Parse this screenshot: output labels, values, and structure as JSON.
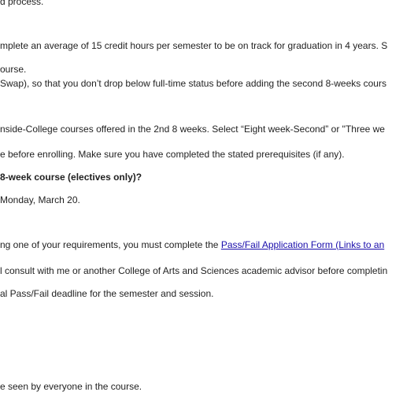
{
  "content": {
    "line1": "d process.",
    "line2": "mplete an average of 15 credit hours per semester to be on track for graduation in 4 years. S",
    "line3": "ourse.",
    "line4": "Swap), so that you don’t drop below full-time status before adding the second 8-weeks cours",
    "line5": "nside-College courses offered in the 2nd 8 weeks. Select “Eight week-Second” or \"Three we",
    "line6": "e before enrolling. Make sure you have completed the stated prerequisites (if any).",
    "line7": "8-week course (electives only)?",
    "line8": "Monday, March 20.",
    "line9_prefix": "ng one of your requirements, you must complete the ",
    "line9_link": "Pass/Fail Application Form (Links to an",
    "line10": "l consult with me or another College of Arts and Sciences academic advisor before completin",
    "line11": "al Pass/Fail deadline for the semester and session.",
    "line12": "e seen by everyone in the course."
  },
  "colors": {
    "link": "#1a0dab",
    "text": "#1f1f1f",
    "background": "#ffffff"
  }
}
